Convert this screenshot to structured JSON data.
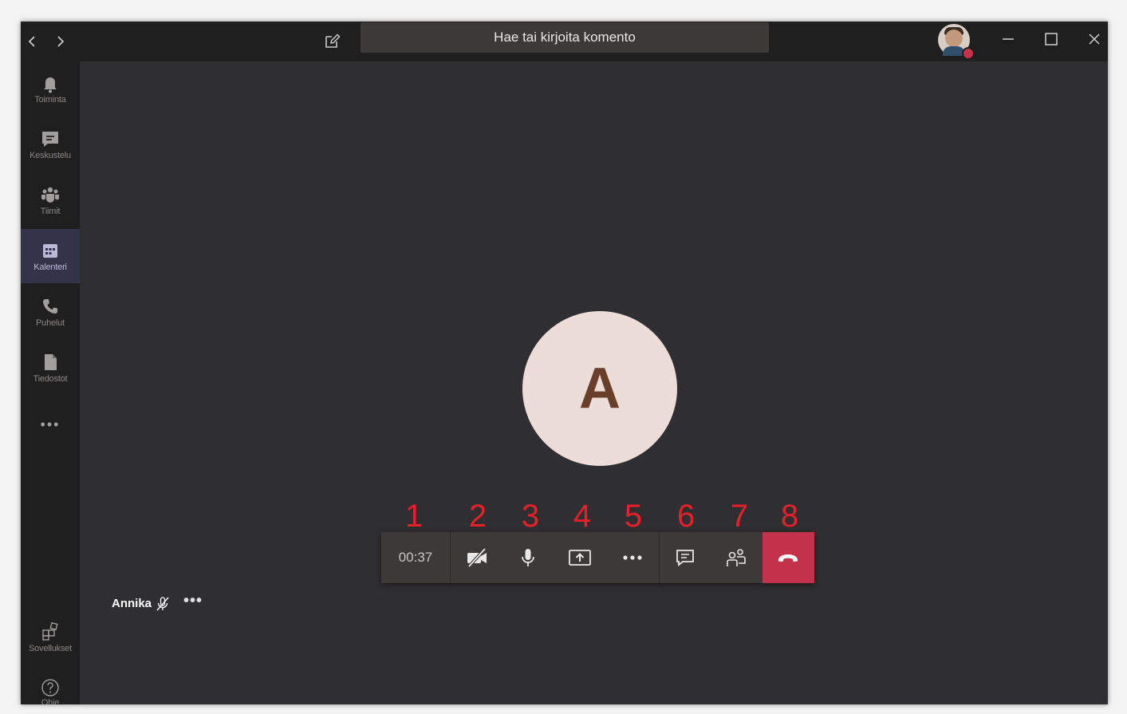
{
  "titlebar": {
    "back_icon": "chevron-left-icon",
    "forward_icon": "chevron-right-icon",
    "search_placeholder": "Hae tai kirjoita komento"
  },
  "rail": {
    "items": [
      {
        "label": "Toiminta",
        "icon": "bell-icon"
      },
      {
        "label": "Keskustelu",
        "icon": "chat-icon"
      },
      {
        "label": "Tiimit",
        "icon": "teams-icon"
      },
      {
        "label": "Kalenteri",
        "icon": "calendar-icon",
        "active": true
      },
      {
        "label": "Puhelut",
        "icon": "phone-icon"
      },
      {
        "label": "Tiedostot",
        "icon": "file-icon"
      }
    ],
    "more": "•••",
    "bottom": [
      {
        "label": "Sovellukset",
        "icon": "apps-icon"
      },
      {
        "label": "Ohje",
        "icon": "help-icon"
      }
    ]
  },
  "stage": {
    "avatar_initial": "A",
    "participant_name": "Annika",
    "participant_more": "•••"
  },
  "callbar": {
    "timer": "00:37",
    "numbers": [
      "1",
      "2",
      "3",
      "4",
      "5",
      "6",
      "7",
      "8"
    ]
  },
  "colors": {
    "hangup": "#c4314b",
    "annotation": "#e8202a",
    "active_rail": "#33344a"
  }
}
